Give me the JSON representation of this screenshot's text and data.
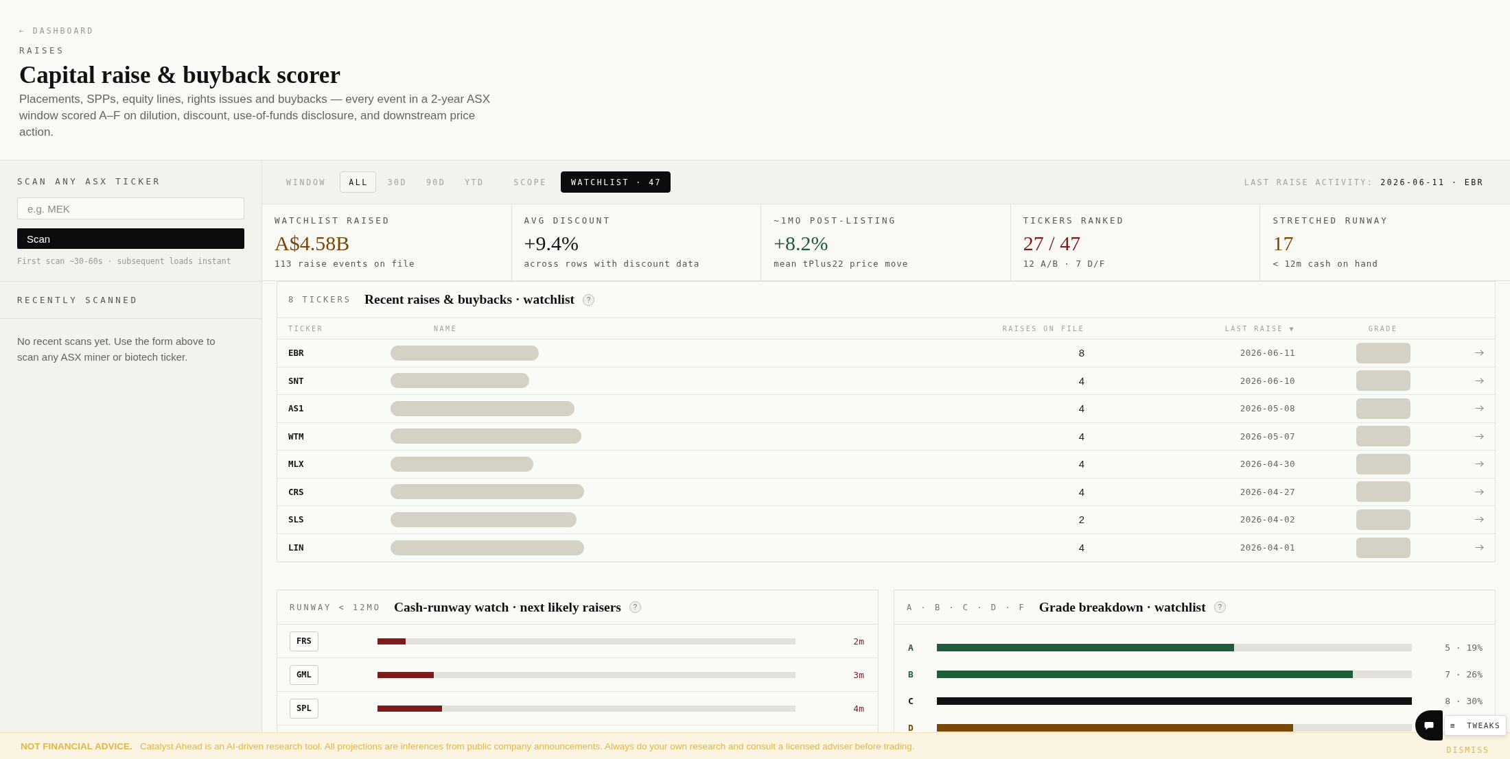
{
  "back_link": "← DASHBOARD",
  "eyebrow": "RAISES",
  "title": "Capital raise & buyback scorer",
  "description": "Placements, SPPs, equity lines, rights issues and buybacks — every event in a 2-year ASX window scored A–F on dilution, discount, use-of-funds disclosure, and downstream price action.",
  "sidebar": {
    "scan": {
      "heading": "SCAN ANY ASX TICKER",
      "placeholder": "e.g. MEK",
      "button": "Scan",
      "hint": "First scan ~30-60s · subsequent loads instant"
    },
    "recent": {
      "heading": "RECENTLY SCANNED",
      "empty_text": "No recent scans yet. Use the form above to scan any ASX miner or biotech ticker."
    }
  },
  "toolbar": {
    "groups": [
      {
        "label": "WINDOW",
        "kind": "outline",
        "options": [
          {
            "label": "ALL",
            "selected": true
          },
          {
            "label": "30D",
            "selected": false
          },
          {
            "label": "90D",
            "selected": false
          },
          {
            "label": "YTD",
            "selected": false
          }
        ]
      },
      {
        "label": "SCOPE",
        "kind": "solid",
        "options": [
          {
            "label": "WATCHLIST · 47",
            "selected": true
          }
        ]
      }
    ],
    "activity_label": "LAST RAISE ACTIVITY:",
    "activity_value": "2026-06-11 · EBR"
  },
  "stats": [
    {
      "label": "WATCHLIST RAISED",
      "value": "A$4.58B",
      "sub": "113 raise events on file",
      "color": "#7a4806"
    },
    {
      "label": "AVG DISCOUNT",
      "value": "+9.4%",
      "sub": "across rows with discount data",
      "color": "#111111"
    },
    {
      "label": "~1MO POST-LISTING",
      "value": "+8.2%",
      "sub": "mean tPlus22 price move",
      "color": "#1f5c3a"
    },
    {
      "label": "TICKERS RANKED",
      "value": "27 / 47",
      "sub": "12 A/B · 7 D/F",
      "color": "#7c1c1c"
    },
    {
      "label": "STRETCHED RUNWAY",
      "value": "17",
      "sub": "< 12m cash on hand",
      "color": "#7a4806"
    }
  ],
  "raises_table": {
    "count": "8 TICKERS",
    "title": "Recent raises & buybacks · watchlist",
    "help": "?",
    "columns": [
      "TICKER",
      "NAME",
      "RAISES ON FILE",
      "LAST RAISE ▼",
      "GRADE"
    ],
    "rows": [
      {
        "ticker": "EBR",
        "raises": "8",
        "last_raise": "2026-06-11",
        "loading": true
      },
      {
        "ticker": "SNT",
        "raises": "4",
        "last_raise": "2026-06-10",
        "loading": true
      },
      {
        "ticker": "AS1",
        "raises": "4",
        "last_raise": "2026-05-08",
        "loading": true
      },
      {
        "ticker": "WTM",
        "raises": "4",
        "last_raise": "2026-05-07",
        "loading": true
      },
      {
        "ticker": "MLX",
        "raises": "4",
        "last_raise": "2026-04-30",
        "loading": true
      },
      {
        "ticker": "CRS",
        "raises": "4",
        "last_raise": "2026-04-27",
        "loading": true
      },
      {
        "ticker": "SLS",
        "raises": "2",
        "last_raise": "2026-04-02",
        "loading": true
      },
      {
        "ticker": "LIN",
        "raises": "4",
        "last_raise": "2026-04-01",
        "loading": true
      }
    ]
  },
  "runway": {
    "tag": "RUNWAY < 12MO",
    "title": "Cash-runway watch · next likely raisers",
    "help": "?",
    "rows": [
      {
        "ticker": "FRS",
        "level": 0.067,
        "reading": "2m"
      },
      {
        "ticker": "GML",
        "level": 0.135,
        "reading": "3m"
      },
      {
        "ticker": "SPL",
        "level": 0.154,
        "reading": "4m"
      }
    ]
  },
  "grades": {
    "tag": "A · B · C · D · F",
    "title": "Grade breakdown · watchlist",
    "help": "?",
    "rows": [
      {
        "grade": "A",
        "level": 0.625,
        "reading": "5 · 19%",
        "color": "#1f5c3a"
      },
      {
        "grade": "B",
        "level": 0.875,
        "reading": "7 · 26%",
        "color": "#1f5c3a"
      },
      {
        "grade": "C",
        "level": 1,
        "reading": "8 · 30%",
        "color": "#111111"
      },
      {
        "grade": "D",
        "level": 0.75,
        "color": "#7a4806"
      }
    ]
  },
  "banner": {
    "lead": "NOT FINANCIAL ADVICE.",
    "text": "Catalyst Ahead is an AI-driven research tool. All projections are inferences from public company announcements. Always do your own research and consult a licensed adviser before trading.",
    "dismiss": "DISMISS"
  },
  "tweaks": {
    "icon": "≡",
    "label": "TWEAKS"
  }
}
